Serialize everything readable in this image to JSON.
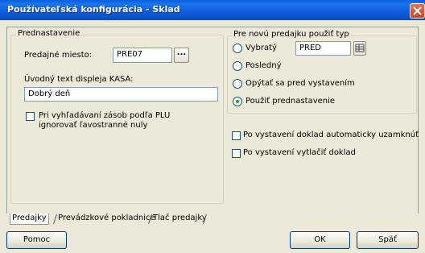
{
  "window": {
    "title": "Používateľská konfigurácia - Sklad"
  },
  "preset_group": {
    "legend": "Prednastavenie",
    "sales_place_label": "Predajné miesto:",
    "sales_place_value": "PRE07",
    "browse_label": "...",
    "display_text_label": "Úvodný text displeja KASA:",
    "display_text_value": "Dobrý deň",
    "plu_checkbox_label_line1": "Pri vyhľadávaní zásob podľa PLU",
    "plu_checkbox_label_line2": "ignorovať ľavostranné nuly"
  },
  "sale_type_group": {
    "legend": "Pre novú predajku použiť typ",
    "options": [
      {
        "label": "Vybratý",
        "checked": false
      },
      {
        "label": "Posledný",
        "checked": false
      },
      {
        "label": "Opýtať sa pred vystavením",
        "checked": false
      },
      {
        "label": "Použiť prednastavenie",
        "checked": true
      }
    ],
    "type_value": "PRED"
  },
  "options": {
    "auto_lock_label": "Po vystavení doklad automaticky uzamknúť",
    "print_label": "Po vystavení vytlačiť doklad"
  },
  "tabs": [
    {
      "label": "Predajky",
      "active": true
    },
    {
      "label": "Prevádzkové pokladnice",
      "active": false
    },
    {
      "label": "Tlač predajky",
      "active": false
    }
  ],
  "buttons": {
    "help": "Pomoc",
    "ok": "OK",
    "back": "Späť"
  },
  "colors": {
    "titlebar": "#0a5fdc",
    "radio_selected": "#21a121",
    "window_bg": "#ece9d8"
  }
}
